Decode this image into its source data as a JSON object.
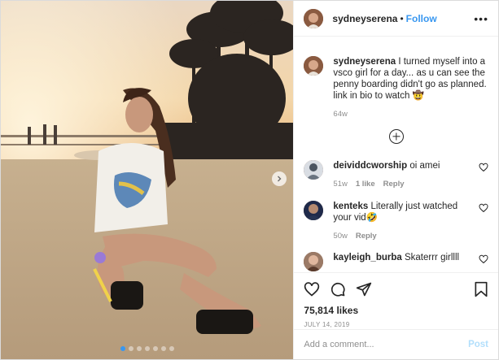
{
  "post": {
    "username": "sydneyserena",
    "separator": "•",
    "follow_label": "Follow",
    "more_label": "•••",
    "carousel": {
      "slide_count": 7,
      "active_index": 0
    }
  },
  "caption": {
    "username": "sydneyserena",
    "text": "I turned myself into a vsco girl for a day... as u can see the penny boarding didn't go as planned. link in bio to watch 🤠",
    "time": "64w"
  },
  "comments": [
    {
      "username": "deividdcworship",
      "text": "oi amei",
      "time": "51w",
      "likes": "1 like",
      "reply": "Reply"
    },
    {
      "username": "kenteks",
      "text": "Literally just watched your vid🤣",
      "time": "50w",
      "likes": "",
      "reply": "Reply"
    },
    {
      "username": "kayleigh_burba",
      "text": "Skaterrr girllll",
      "time": "",
      "likes": "",
      "reply": ""
    }
  ],
  "stats": {
    "likes": "75,814 likes",
    "date": "JULY 14, 2019"
  },
  "composer": {
    "placeholder": "Add a comment...",
    "post_label": "Post"
  },
  "colors": {
    "accent": "#3897f0",
    "text": "#262626",
    "muted": "#8e8e8e",
    "post_disabled": "#b2dffc"
  }
}
